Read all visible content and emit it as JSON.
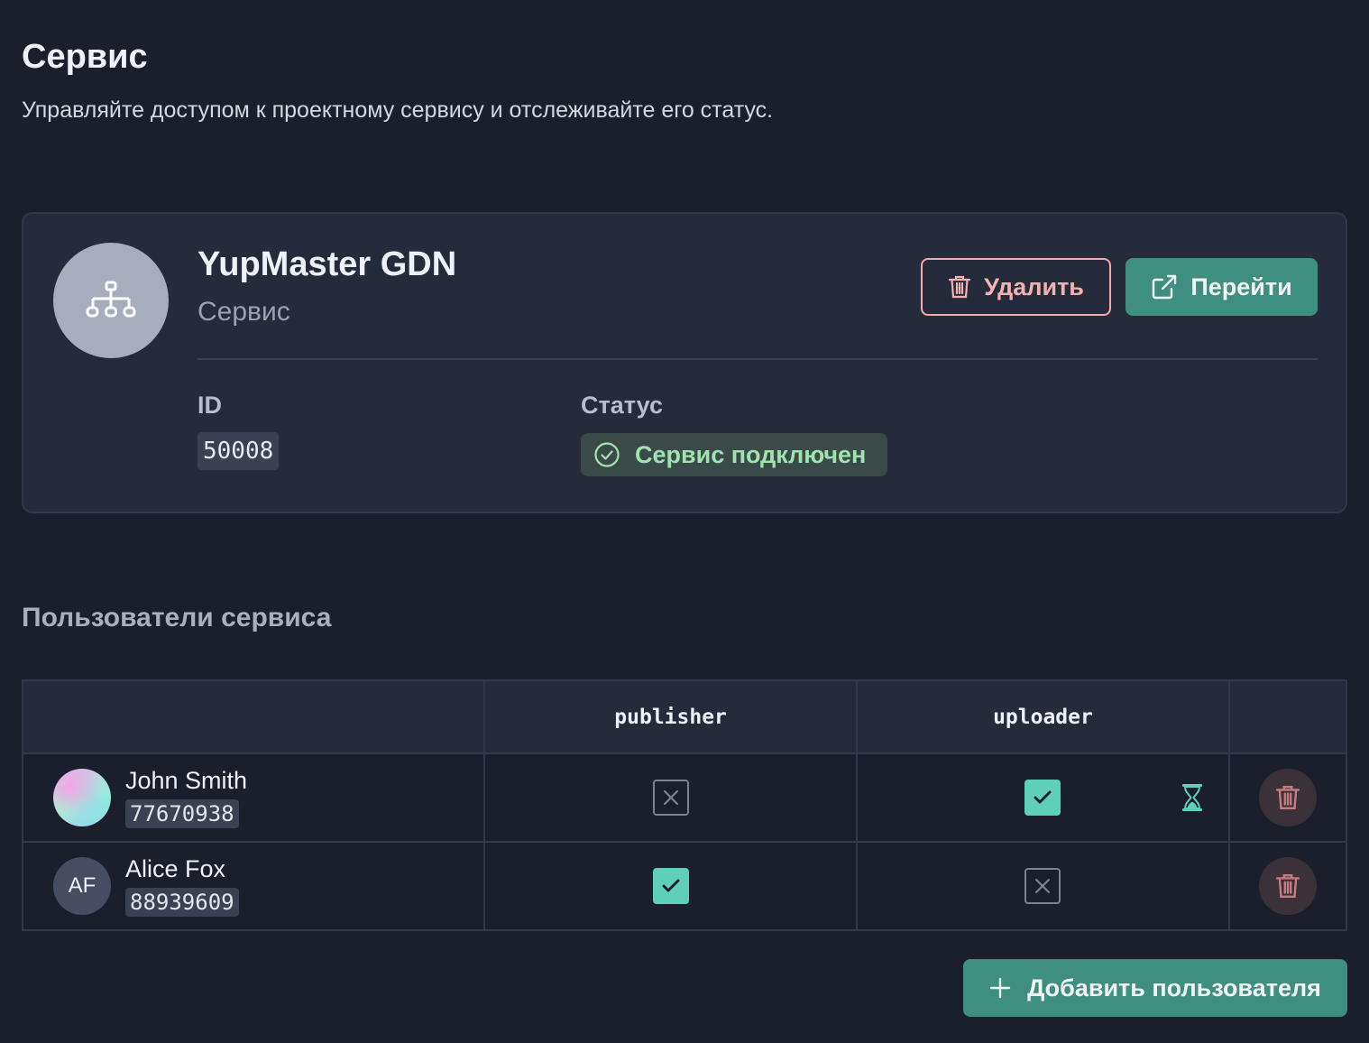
{
  "header": {
    "title": "Сервис",
    "subtitle": "Управляйте доступом к проектному сервису и отслеживайте его статус."
  },
  "service": {
    "name": "YupMaster GDN",
    "kind": "Сервис",
    "icon": "sitemap-icon",
    "delete_label": "Удалить",
    "go_label": "Перейти",
    "id_label": "ID",
    "id_value": "50008",
    "status_label": "Статус",
    "status_text": "Сервис подключен"
  },
  "users_section": {
    "title": "Пользователи сервиса",
    "columns": [
      "",
      "publisher",
      "uploader",
      ""
    ],
    "rows": [
      {
        "name": "John Smith",
        "id": "77670938",
        "avatar": "gradient",
        "initials": "",
        "publisher": false,
        "uploader": true,
        "uploader_pending": true
      },
      {
        "name": "Alice Fox",
        "id": "88939609",
        "avatar": "initials",
        "initials": "AF",
        "publisher": true,
        "uploader": false,
        "uploader_pending": false
      }
    ],
    "add_label": "Добавить пользователя"
  },
  "colors": {
    "background": "#1b1f2b",
    "card": "#252b3a",
    "accent": "#3f8f80",
    "danger": "#f1a9a9",
    "checkbox": "#5fd0b8",
    "status_text": "#9fe3b0"
  }
}
